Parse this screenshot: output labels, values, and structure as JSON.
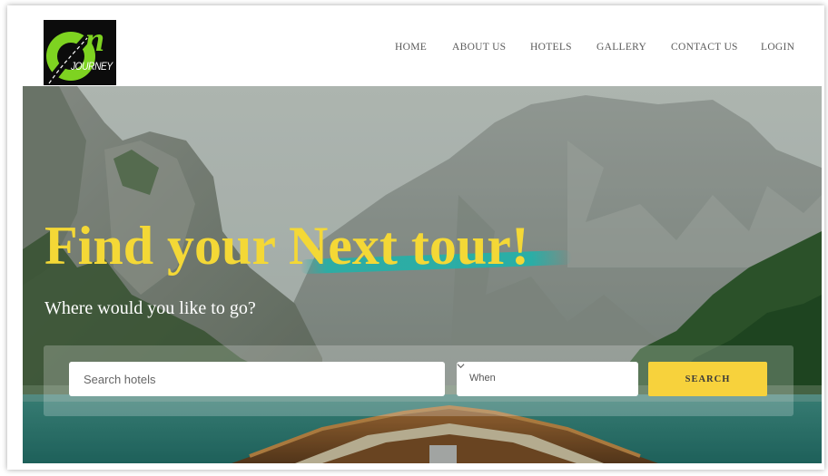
{
  "brand": {
    "logo_letter": "n",
    "logo_text": "JOURNEY"
  },
  "nav": {
    "items": [
      {
        "label": "HOME"
      },
      {
        "label": "ABOUT US"
      },
      {
        "label": "HOTELS"
      },
      {
        "label": "GALLERY"
      },
      {
        "label": "CONTACT US"
      },
      {
        "label": "LOGIN"
      }
    ]
  },
  "hero": {
    "title": "Find your Next tour!",
    "subtitle": "Where would you like to go?"
  },
  "search": {
    "input_placeholder": "Search hotels",
    "input_value": "",
    "when_label": "When",
    "button_label": "SEARCH"
  },
  "colors": {
    "title_yellow": "#f4d836",
    "brush_teal": "#20b2aa",
    "button_yellow": "#f7d23c",
    "logo_green": "#7ed321",
    "logo_black": "#0c0c0c"
  },
  "icons": {
    "when_dropdown": "chevron-down-icon"
  }
}
